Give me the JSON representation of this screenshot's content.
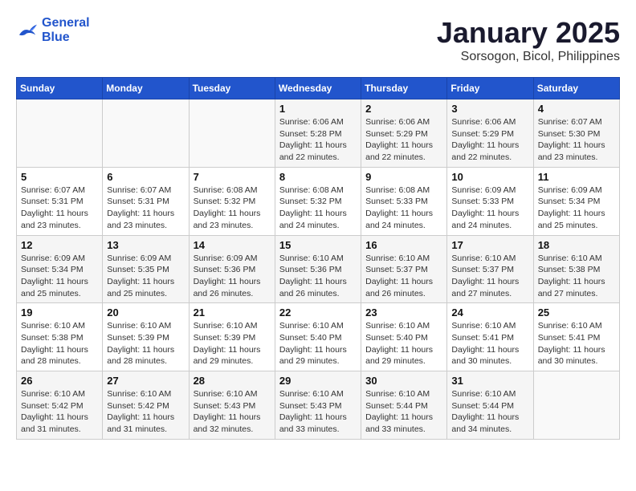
{
  "header": {
    "logo_line1": "General",
    "logo_line2": "Blue",
    "month_title": "January 2025",
    "location": "Sorsogon, Bicol, Philippines"
  },
  "weekdays": [
    "Sunday",
    "Monday",
    "Tuesday",
    "Wednesday",
    "Thursday",
    "Friday",
    "Saturday"
  ],
  "weeks": [
    [
      {
        "day": "",
        "info": ""
      },
      {
        "day": "",
        "info": ""
      },
      {
        "day": "",
        "info": ""
      },
      {
        "day": "1",
        "info": "Sunrise: 6:06 AM\nSunset: 5:28 PM\nDaylight: 11 hours\nand 22 minutes."
      },
      {
        "day": "2",
        "info": "Sunrise: 6:06 AM\nSunset: 5:29 PM\nDaylight: 11 hours\nand 22 minutes."
      },
      {
        "day": "3",
        "info": "Sunrise: 6:06 AM\nSunset: 5:29 PM\nDaylight: 11 hours\nand 22 minutes."
      },
      {
        "day": "4",
        "info": "Sunrise: 6:07 AM\nSunset: 5:30 PM\nDaylight: 11 hours\nand 23 minutes."
      }
    ],
    [
      {
        "day": "5",
        "info": "Sunrise: 6:07 AM\nSunset: 5:31 PM\nDaylight: 11 hours\nand 23 minutes."
      },
      {
        "day": "6",
        "info": "Sunrise: 6:07 AM\nSunset: 5:31 PM\nDaylight: 11 hours\nand 23 minutes."
      },
      {
        "day": "7",
        "info": "Sunrise: 6:08 AM\nSunset: 5:32 PM\nDaylight: 11 hours\nand 23 minutes."
      },
      {
        "day": "8",
        "info": "Sunrise: 6:08 AM\nSunset: 5:32 PM\nDaylight: 11 hours\nand 24 minutes."
      },
      {
        "day": "9",
        "info": "Sunrise: 6:08 AM\nSunset: 5:33 PM\nDaylight: 11 hours\nand 24 minutes."
      },
      {
        "day": "10",
        "info": "Sunrise: 6:09 AM\nSunset: 5:33 PM\nDaylight: 11 hours\nand 24 minutes."
      },
      {
        "day": "11",
        "info": "Sunrise: 6:09 AM\nSunset: 5:34 PM\nDaylight: 11 hours\nand 25 minutes."
      }
    ],
    [
      {
        "day": "12",
        "info": "Sunrise: 6:09 AM\nSunset: 5:34 PM\nDaylight: 11 hours\nand 25 minutes."
      },
      {
        "day": "13",
        "info": "Sunrise: 6:09 AM\nSunset: 5:35 PM\nDaylight: 11 hours\nand 25 minutes."
      },
      {
        "day": "14",
        "info": "Sunrise: 6:09 AM\nSunset: 5:36 PM\nDaylight: 11 hours\nand 26 minutes."
      },
      {
        "day": "15",
        "info": "Sunrise: 6:10 AM\nSunset: 5:36 PM\nDaylight: 11 hours\nand 26 minutes."
      },
      {
        "day": "16",
        "info": "Sunrise: 6:10 AM\nSunset: 5:37 PM\nDaylight: 11 hours\nand 26 minutes."
      },
      {
        "day": "17",
        "info": "Sunrise: 6:10 AM\nSunset: 5:37 PM\nDaylight: 11 hours\nand 27 minutes."
      },
      {
        "day": "18",
        "info": "Sunrise: 6:10 AM\nSunset: 5:38 PM\nDaylight: 11 hours\nand 27 minutes."
      }
    ],
    [
      {
        "day": "19",
        "info": "Sunrise: 6:10 AM\nSunset: 5:38 PM\nDaylight: 11 hours\nand 28 minutes."
      },
      {
        "day": "20",
        "info": "Sunrise: 6:10 AM\nSunset: 5:39 PM\nDaylight: 11 hours\nand 28 minutes."
      },
      {
        "day": "21",
        "info": "Sunrise: 6:10 AM\nSunset: 5:39 PM\nDaylight: 11 hours\nand 29 minutes."
      },
      {
        "day": "22",
        "info": "Sunrise: 6:10 AM\nSunset: 5:40 PM\nDaylight: 11 hours\nand 29 minutes."
      },
      {
        "day": "23",
        "info": "Sunrise: 6:10 AM\nSunset: 5:40 PM\nDaylight: 11 hours\nand 29 minutes."
      },
      {
        "day": "24",
        "info": "Sunrise: 6:10 AM\nSunset: 5:41 PM\nDaylight: 11 hours\nand 30 minutes."
      },
      {
        "day": "25",
        "info": "Sunrise: 6:10 AM\nSunset: 5:41 PM\nDaylight: 11 hours\nand 30 minutes."
      }
    ],
    [
      {
        "day": "26",
        "info": "Sunrise: 6:10 AM\nSunset: 5:42 PM\nDaylight: 11 hours\nand 31 minutes."
      },
      {
        "day": "27",
        "info": "Sunrise: 6:10 AM\nSunset: 5:42 PM\nDaylight: 11 hours\nand 31 minutes."
      },
      {
        "day": "28",
        "info": "Sunrise: 6:10 AM\nSunset: 5:43 PM\nDaylight: 11 hours\nand 32 minutes."
      },
      {
        "day": "29",
        "info": "Sunrise: 6:10 AM\nSunset: 5:43 PM\nDaylight: 11 hours\nand 33 minutes."
      },
      {
        "day": "30",
        "info": "Sunrise: 6:10 AM\nSunset: 5:44 PM\nDaylight: 11 hours\nand 33 minutes."
      },
      {
        "day": "31",
        "info": "Sunrise: 6:10 AM\nSunset: 5:44 PM\nDaylight: 11 hours\nand 34 minutes."
      },
      {
        "day": "",
        "info": ""
      }
    ]
  ]
}
